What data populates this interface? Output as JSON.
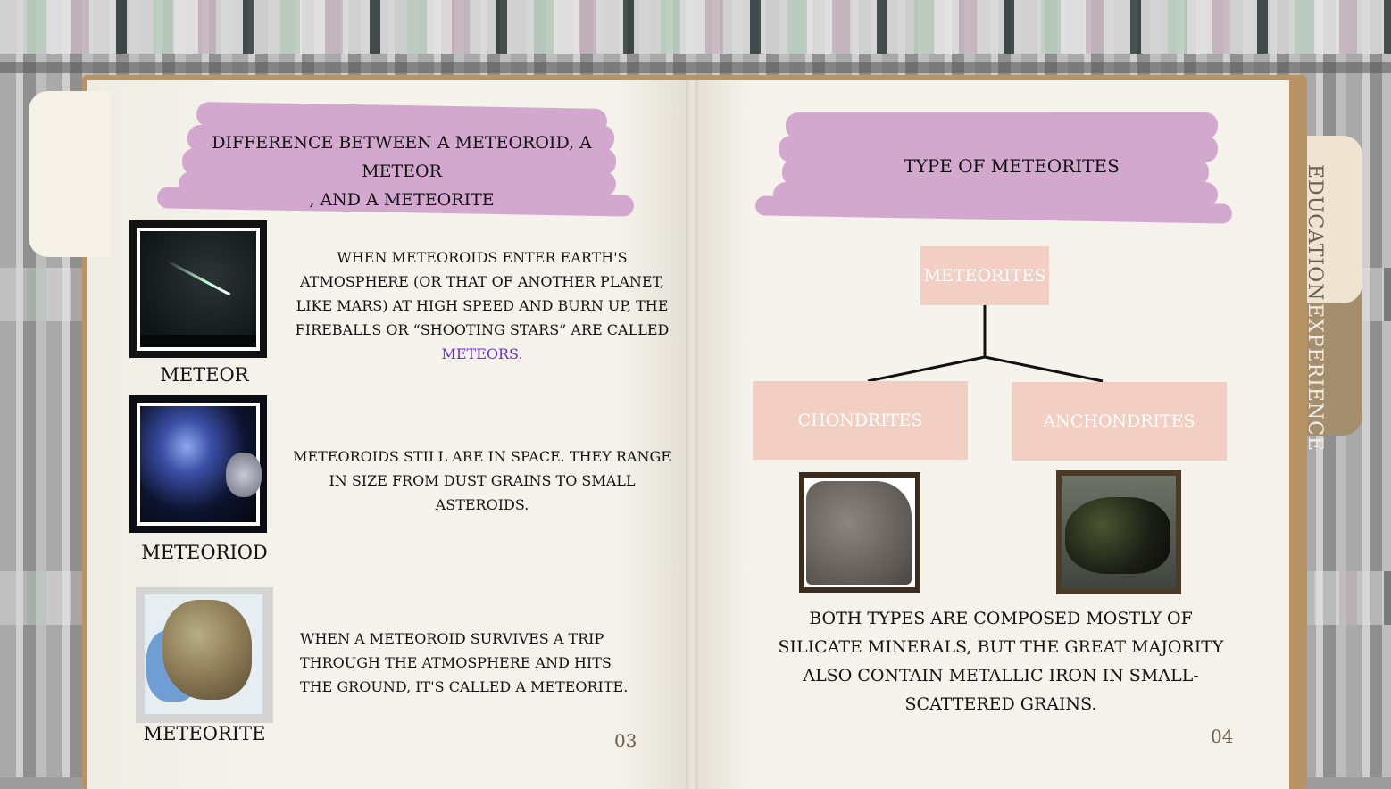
{
  "left_page": {
    "title_line1": "DIFFERENCE BETWEEN A METEOROID, A METEOR",
    "title_line2": ", AND A METEORITE",
    "items": [
      {
        "caption": "METEOR",
        "text": "WHEN METEOROIDS ENTER EARTH'S ATMOSPHERE (OR THAT OF ANOTHER PLANET, LIKE MARS) AT HIGH SPEED AND BURN UP, THE FIREBALLS OR “SHOOTING STARS” ARE CALLED ",
        "highlight": "METEORS."
      },
      {
        "caption": "METEORIOD",
        "text": "METEOROIDS STILL ARE IN SPACE. THEY RANGE IN SIZE FROM DUST GRAINS TO SMALL ASTEROIDS."
      },
      {
        "caption": "METEORITE",
        "text": "WHEN A METEOROID SURVIVES A TRIP THROUGH THE ATMOSPHERE AND HITS THE GROUND, IT'S CALLED A METEORITE."
      }
    ],
    "page_number": "03"
  },
  "right_page": {
    "title": "TYPE OF METEORITES",
    "diagram": {
      "root": "METEORITES",
      "children": [
        "CHONDRITES",
        "ANCHONDRITES"
      ]
    },
    "text": "BOTH TYPES ARE COMPOSED MOSTLY OF SILICATE MINERALS, BUT THE GREAT MAJORITY ALSO CONTAIN METALLIC IRON IN SMALL-SCATTERED GRAINS.",
    "page_number": "04"
  },
  "tabs": {
    "education": "EDUCATION",
    "experience": "EXPERIENCE"
  },
  "colors": {
    "brush": "#d3a8cf",
    "node": "#f2cfc2",
    "highlight": "#6a2bd8",
    "tab_education": "#efe3d2",
    "tab_experience": "#a48e6e"
  }
}
